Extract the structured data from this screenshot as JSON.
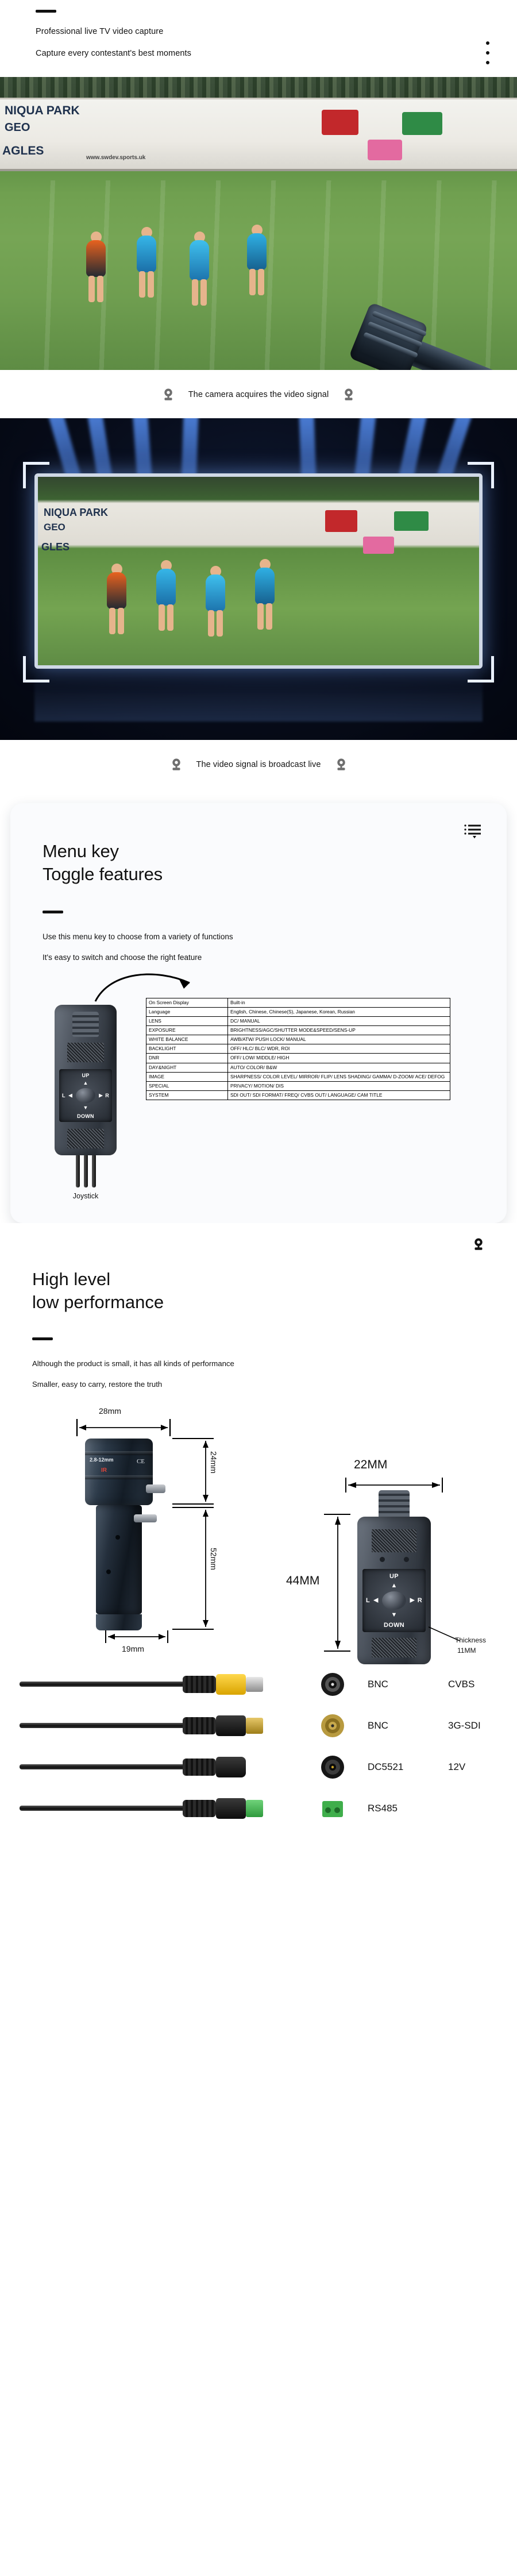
{
  "section_intro": {
    "line1": "Professional live TV video capture",
    "line2": "Capture every contestant's best moments"
  },
  "caption_1": {
    "text": "The camera acquires the video signal",
    "icon": "webcam-icon"
  },
  "caption_2": {
    "text": "The video signal is broadcast live",
    "icon": "webcam-icon"
  },
  "stadium_ads": {
    "ad1": "NIQUA PARK",
    "ad2": "GEO",
    "ad3": "AGLES",
    "ad4": "www.swdev.sports.uk"
  },
  "menu_card": {
    "list_icon": "list-menu-icon",
    "heading_line1": "Menu key",
    "heading_line2": "Toggle features",
    "sub_line1": "Use this menu key to choose from a variety of functions",
    "sub_line2": "It's easy to switch and choose the right feature",
    "joystick_caption": "Joystick",
    "joystick_labels": {
      "up": "UP",
      "down": "DOWN",
      "left": "L",
      "right": "R"
    }
  },
  "spec_table": {
    "rows": [
      {
        "key": "On Screen Display",
        "value": "Built-in"
      },
      {
        "key": "Language",
        "value": "English, Chinese, Chinese(S), Japanese, Korean, Russian"
      },
      {
        "key": "LENS",
        "value": "DC/ MANUAL"
      },
      {
        "key": "EXPOSURE",
        "value": "BRIGHTNESS/AGC/SHUTTER MODE&SPEED/SENS-UP"
      },
      {
        "key": "WHITE BALANCE",
        "value": "AWB/ATW/ PUSH LOCK/ MANUAL"
      },
      {
        "key": "BACKLIGHT",
        "value": "OFF/ HLC/ BLC/ WDR, ROI"
      },
      {
        "key": "DNR",
        "value": "OFF/ LOW/ MIDDLE/ HIGH"
      },
      {
        "key": "DAY&NIGHT",
        "value": "AUTO/ COLOR/ B&W"
      },
      {
        "key": "IMAGE",
        "value": "SHARPNESS/ COLOR LEVEL/ MIRROR/ FLIP/ LENS SHADING/ GAMMA/ D-ZOOM/ ACE/ DEFOG"
      },
      {
        "key": "SPECIAL",
        "value": "PRIVACY/ MOTION/ DIS"
      },
      {
        "key": "SYSTEM",
        "value": "SDI OUT/ SDI FORMAT/ FREQ/ CVBS OUT/ LANGUAGE/ CAM TITLE"
      }
    ]
  },
  "performance": {
    "camera_icon": "webcam-icon",
    "heading_line1": "High level",
    "heading_line2": "low performance",
    "sub_line1": "Although the product is small, it has all kinds of performance",
    "sub_line2": "Smaller, easy to carry, restore the truth"
  },
  "dimensions": {
    "camera_width": "28mm",
    "camera_lens_height": "24mm",
    "camera_body_height": "52mm",
    "camera_tube_width": "19mm",
    "joystick_width": "22MM",
    "joystick_height": "44MM",
    "joystick_thickness_line1": "Thickness",
    "joystick_thickness_line2": "11MM",
    "lens_marking": "2.8-12mm",
    "lens_badge_ce": "CE",
    "lens_badge_ir": "IR"
  },
  "connectors": [
    {
      "name": "BNC",
      "type": "CVBS",
      "icon": "bnc-connector-icon",
      "plug_color": "#f2c200"
    },
    {
      "name": "BNC",
      "type": "3G-SDI",
      "icon": "bnc-sdi-connector-icon",
      "plug_color": "#c9a227"
    },
    {
      "name": "DC5521",
      "type": "12V",
      "icon": "dc-barrel-connector-icon",
      "plug_color": "#2a2a2a"
    },
    {
      "name": "RS485",
      "type": "",
      "icon": "terminal-block-icon",
      "plug_color": "#4caf50"
    }
  ],
  "colors": {
    "accent_blue": "#2f6fd0",
    "text": "#111111",
    "card_bg": "#fafbfd"
  }
}
